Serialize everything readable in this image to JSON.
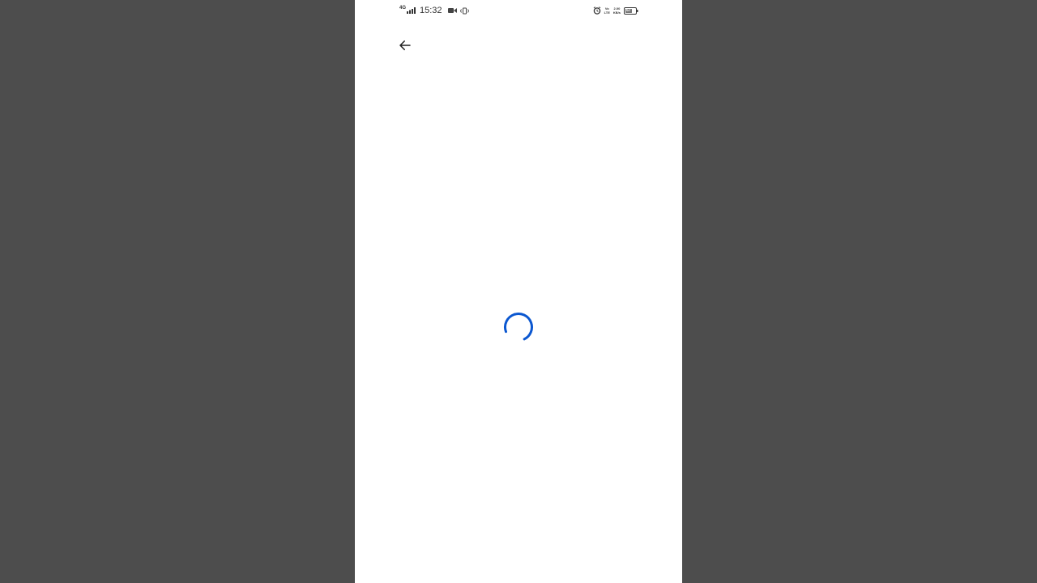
{
  "status_bar": {
    "network_type": "4G",
    "time": "15:32",
    "volte_top": "Vo",
    "volte_bottom": "LTE",
    "speed_value": "2.00",
    "speed_unit": "KB/s",
    "battery_level": "67",
    "icons": [
      "signal-icon",
      "video-record-icon",
      "vibrate-icon",
      "alarm-icon",
      "battery-icon"
    ]
  },
  "toolbar": {
    "back_icon": "arrow-left-icon"
  },
  "loading": {
    "spinner_icon": "loading-spinner-icon"
  },
  "colors": {
    "backdrop": "#4d4d4d",
    "screen": "#ffffff",
    "spinner": "#0b57d0",
    "icon": "#1f1f1f",
    "status_text": "#333333"
  }
}
